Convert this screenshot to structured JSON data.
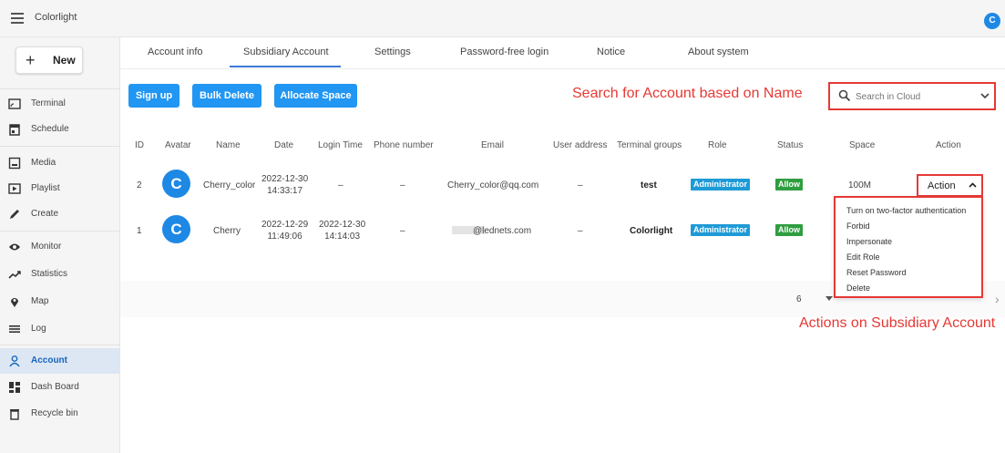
{
  "app": {
    "title": "Colorlight",
    "user_initial": "C"
  },
  "sidebar": {
    "new_label": "New",
    "items": [
      {
        "label": "Terminal",
        "icon": "terminal-icon"
      },
      {
        "label": "Schedule",
        "icon": "calendar-icon"
      },
      {
        "label": "Media",
        "icon": "media-icon"
      },
      {
        "label": "Playlist",
        "icon": "playlist-icon"
      },
      {
        "label": "Create",
        "icon": "pencil-icon"
      },
      {
        "label": "Monitor",
        "icon": "eye-icon"
      },
      {
        "label": "Statistics",
        "icon": "trend-icon"
      },
      {
        "label": "Map",
        "icon": "location-pin-icon"
      },
      {
        "label": "Log",
        "icon": "list-icon"
      },
      {
        "label": "Account",
        "icon": "person-icon",
        "active": true
      },
      {
        "label": "Dash Board",
        "icon": "dashboard-icon"
      },
      {
        "label": "Recycle bin",
        "icon": "trash-icon"
      }
    ]
  },
  "tabs": [
    "Account info",
    "Subsidiary Account",
    "Settings",
    "Password-free login",
    "Notice",
    "About system"
  ],
  "active_tab": "Subsidiary Account",
  "toolbar": {
    "signup": "Sign up",
    "bulk_delete": "Bulk Delete",
    "allocate": "Allocate Space"
  },
  "search": {
    "annotation": "Search for Account based on Name",
    "placeholder": "Search in Cloud"
  },
  "table": {
    "headers": [
      "ID",
      "Avatar",
      "Name",
      "Date",
      "Login Time",
      "Phone number",
      "Email",
      "User address",
      "Terminal groups",
      "Role",
      "Status",
      "Space",
      "Action"
    ],
    "rows": [
      {
        "id": "2",
        "avatar": "C",
        "name": "Cherry_color",
        "date1": "2022-12-30",
        "date2": "14:33:17",
        "login": "–",
        "phone": "–",
        "email": "Cherry_color@qq.com",
        "address": "–",
        "group": "test",
        "role": "Administrator",
        "status": "Allow",
        "space": "100M"
      },
      {
        "id": "1",
        "avatar": "C",
        "name": "Cherry",
        "date1": "2022-12-29",
        "date2": "11:49:06",
        "login1": "2022-12-30",
        "login2": "14:14:03",
        "phone": "–",
        "email": "@lednets.com",
        "address": "–",
        "group": "Colorlight",
        "role": "Administrator",
        "status": "Allow"
      }
    ]
  },
  "action": {
    "button_label": "Action",
    "menu": [
      "Turn on two-factor authentication",
      "Forbid",
      "Impersonate",
      "Edit Role",
      "Reset Password",
      "Delete"
    ],
    "annotation": "Actions on Subsidiary Account"
  },
  "pager": {
    "rows_per_page": "6"
  },
  "colors": {
    "primary": "#2196f3",
    "annotation_red": "#e53935",
    "admin_badge": "#1e9ad6",
    "allow_badge": "#2e9e3f"
  }
}
